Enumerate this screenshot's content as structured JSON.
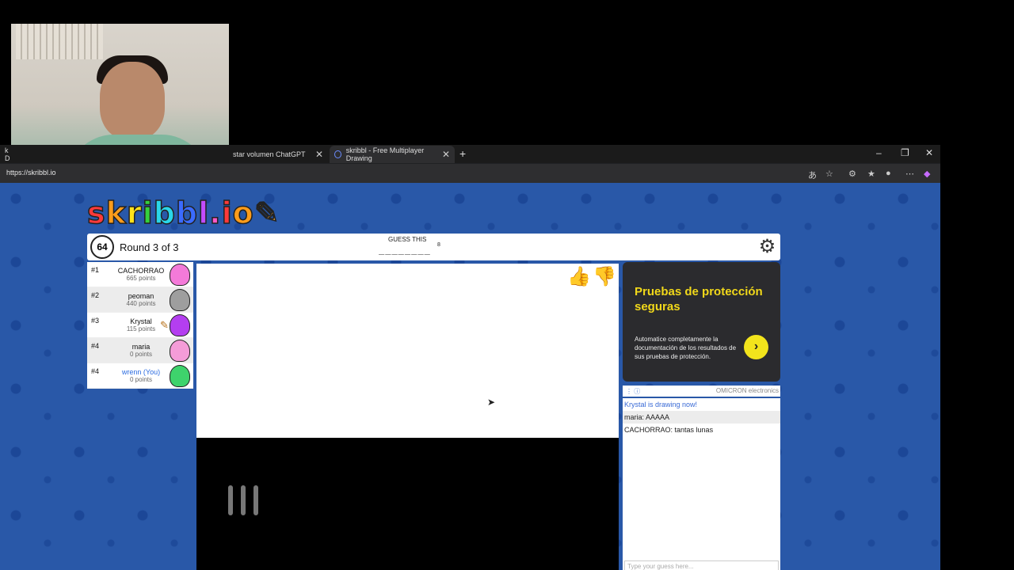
{
  "browser": {
    "tabs": [
      {
        "label": "k D"
      },
      {
        "label": "star volumen ChatGPT"
      },
      {
        "label": "skribbl - Free Multiplayer Drawing"
      }
    ],
    "url": "https://skribbl.io"
  },
  "game": {
    "logo_parts": [
      "s",
      "k",
      "r",
      "i",
      "b",
      "b",
      "l",
      ".",
      "i",
      "o"
    ],
    "timer": "64",
    "round": "Round 3 of 3",
    "guess_label": "GUESS THIS",
    "guess_word": "________",
    "guess_letters": "8"
  },
  "players": [
    {
      "rank": "#1",
      "name": "CACHORRAO",
      "points": "665 points",
      "color": "#f47ad9"
    },
    {
      "rank": "#2",
      "name": "peoman",
      "points": "440 points",
      "color": "#9e9e9e"
    },
    {
      "rank": "#3",
      "name": "Krystal",
      "points": "115 points",
      "color": "#b43ef0"
    },
    {
      "rank": "#4",
      "name": "maria",
      "points": "0 points",
      "color": "#f49cd8"
    },
    {
      "rank": "#4",
      "name": "wrenn (You)",
      "points": "0 points",
      "color": "#3ed36c"
    }
  ],
  "ad": {
    "title": "Pruebas de protección seguras",
    "text": "Automatice completamente la documentación de los resultados de sus pruebas de protección.",
    "brand": "OMICRON electronics"
  },
  "chat": {
    "messages": [
      {
        "author": "",
        "text": "Krystal is drawing now!"
      },
      {
        "author": "maria:",
        "text": "AAAAA"
      },
      {
        "author": "CACHORRAO:",
        "text": "tantas lunas"
      }
    ],
    "placeholder": "Type your guess here..."
  }
}
